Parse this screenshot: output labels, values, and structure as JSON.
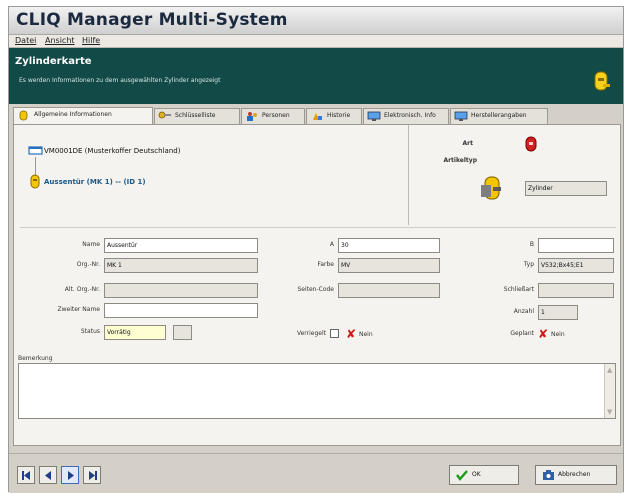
{
  "window": {
    "title": "CLIQ Manager Multi-System"
  },
  "menu": {
    "file": "Datei",
    "view": "Ansicht",
    "help": "Hilfe"
  },
  "banner": {
    "title": "Zylinderkarte",
    "subtitle": "Es werden Informationen zu dem ausgewählten Zylinder angezeigt",
    "icon": "cylinder-key-icon"
  },
  "tabs": [
    {
      "label": "Allgemeine Informationen",
      "icon": "cylinder-icon",
      "active": true
    },
    {
      "label": "Schlüsselliste",
      "icon": "keys-icon",
      "active": false
    },
    {
      "label": "Personen",
      "icon": "people-icon",
      "active": false
    },
    {
      "label": "Historie",
      "icon": "history-icon",
      "active": false
    },
    {
      "label": "Elektronisch. Info",
      "icon": "monitor-icon",
      "active": false
    },
    {
      "label": "Herstellerangaben",
      "icon": "monitor-icon",
      "active": false
    }
  ],
  "tree": {
    "root": "VM0001DE (Musterkoffer Deutschland)",
    "child": "Aussentür (MK 1) -- (ID 1)"
  },
  "info": {
    "art_label": "Art",
    "artikeltyp_label": "Artikeltyp",
    "artikeltyp_value": "Zylinder"
  },
  "form": {
    "name_label": "Name",
    "name_value": "Aussentür",
    "orgnr_label": "Org.-Nr.",
    "orgnr_value": "MK 1",
    "alt_orgnr_label": "Alt. Org.-Nr.",
    "alt_orgnr_value": "",
    "zweiter_name_label": "Zweiter Name",
    "zweiter_name_value": "",
    "status_label": "Status",
    "status_value": "Vorrätig",
    "a_label": "A",
    "a_value": "30",
    "farbe_label": "Farbe",
    "farbe_value": "MV",
    "seiten_code_label": "Seiten-Code",
    "seiten_code_value": "",
    "verriegelt_label": "Verriegelt",
    "verriegelt_value": "Nein",
    "b_label": "B",
    "b_value": "",
    "typ_label": "Typ",
    "typ_value": "V532;Bx45;E1",
    "schliessart_label": "Schließart",
    "schliessart_value": "",
    "anzahl_label": "Anzahl",
    "anzahl_value": "1",
    "geplant_label": "Geplant",
    "geplant_value": "Nein"
  },
  "bemerkung": {
    "label": "Bemerkung",
    "value": ""
  },
  "buttons": {
    "ok": "OK",
    "cancel": "Abbrechen"
  },
  "colors": {
    "banner": "#114a46",
    "x_mark": "#d01818",
    "window_bg": "#d4d0c8"
  }
}
